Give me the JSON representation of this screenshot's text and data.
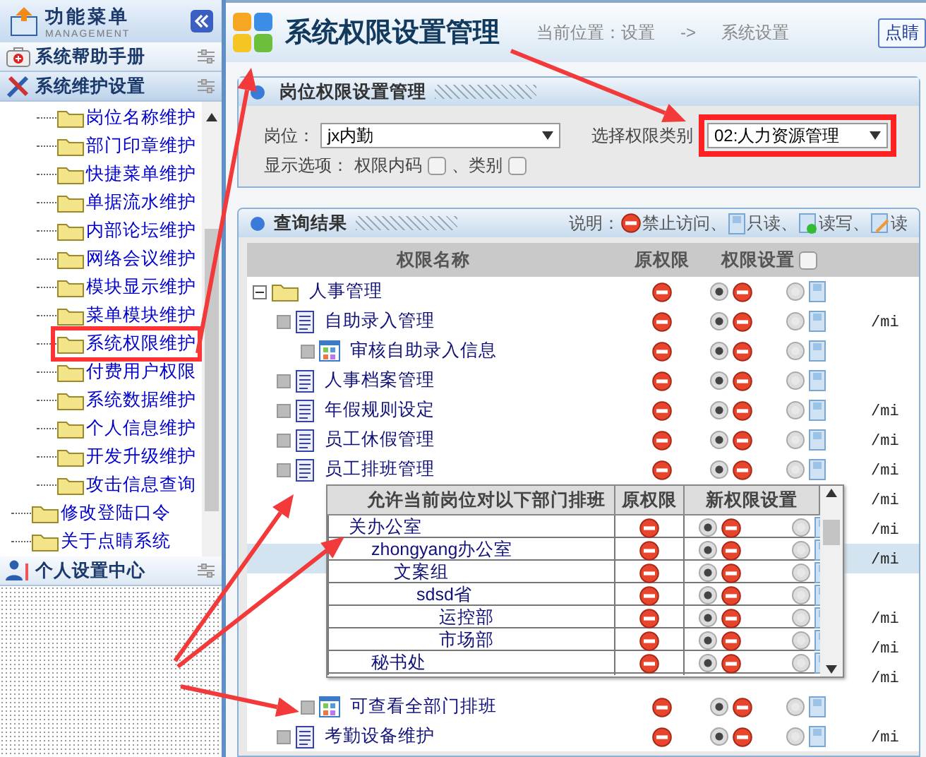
{
  "sidebar": {
    "title": "功能菜单",
    "subtitle": "MANAGEMENT",
    "sections": [
      {
        "kind": "help",
        "label": "系统帮助手册",
        "expanded": false
      },
      {
        "kind": "tools",
        "label": "系统维护设置",
        "expanded": true,
        "items": [
          {
            "children": [
              {
                "label": "岗位名称维护",
                "selected": false
              },
              {
                "label": "部门印章维护",
                "selected": false
              },
              {
                "label": "快捷菜单维护",
                "selected": false
              },
              {
                "label": "单据流水维护",
                "selected": false
              },
              {
                "label": "内部论坛维护",
                "selected": false
              },
              {
                "label": "网络会议维护",
                "selected": false
              },
              {
                "label": "模块显示维护",
                "selected": false
              },
              {
                "label": "菜单模块维护",
                "selected": false
              },
              {
                "label": "系统权限维护",
                "selected": true
              },
              {
                "label": "付费用户权限",
                "selected": false
              },
              {
                "label": "系统数据维护",
                "selected": false
              },
              {
                "label": "个人信息维护",
                "selected": false
              },
              {
                "label": "开发升级维护",
                "selected": false
              },
              {
                "label": "攻击信息查询",
                "selected": false
              }
            ]
          },
          {
            "label": "修改登陆口令",
            "selected": false
          },
          {
            "label": "关于点睛系统",
            "selected": false
          }
        ]
      },
      {
        "kind": "user",
        "label": "个人设置中心",
        "expanded": false
      }
    ]
  },
  "header": {
    "title": "系统权限设置管理",
    "breadcrumb": [
      "当前位置：设置",
      "->",
      "系统设置"
    ],
    "button": "点睛"
  },
  "filter_panel": {
    "title": "岗位权限设置管理",
    "post_label": "岗位：",
    "post_value": "jx内勤",
    "category_label": "选择权限类别",
    "category_value": "02:人力资源管理",
    "category_highlighted": true,
    "options_label": "显示选项：",
    "options": [
      {
        "label": "权限内码",
        "checked": false
      },
      {
        "label": "、类别",
        "checked": false
      }
    ]
  },
  "results": {
    "title": "查询结果",
    "legend_label": "说明：",
    "legend": [
      {
        "kind": "forbid",
        "label": "禁止访问、"
      },
      {
        "kind": "readonly",
        "label": "只读、"
      },
      {
        "kind": "readwrite",
        "label": "读写、"
      },
      {
        "kind": "edit",
        "label": "读"
      }
    ],
    "columns": [
      "权限名称",
      "原权限",
      "权限设置"
    ],
    "select_all": false,
    "rows": [
      {
        "kind": "folder",
        "name": "人事管理",
        "expanded": true,
        "forbid_selected": true,
        "children": [
          {
            "kind": "page",
            "name": "自助录入管理",
            "path": "/mi",
            "forbid_selected": true,
            "children": [
              {
                "kind": "module",
                "name": "审核自助录入信息",
                "forbid_selected": true
              }
            ]
          },
          {
            "kind": "page",
            "name": "人事档案管理",
            "forbid_selected": true
          },
          {
            "kind": "page",
            "name": "年假规则设定",
            "path": "/mi",
            "forbid_selected": true
          },
          {
            "kind": "page",
            "name": "员工休假管理",
            "path": "/mi",
            "forbid_selected": true
          },
          {
            "kind": "page",
            "name": "员工排班管理",
            "path": "/mi",
            "forbid_selected": true,
            "children": [
              {
                "kind": "covered",
                "path": "/mi",
                "selected": false
              },
              {
                "kind": "covered",
                "path": "/mi",
                "selected": false
              },
              {
                "kind": "covered",
                "path": "/mi",
                "selected": true
              },
              {
                "kind": "covered",
                "selected": false
              },
              {
                "kind": "covered",
                "path": "/mi",
                "selected": false
              },
              {
                "kind": "covered",
                "path": "/mi",
                "selected": false
              },
              {
                "kind": "covered",
                "path": "/mi",
                "selected": false
              },
              {
                "kind": "module",
                "name": "可查看全部门排班",
                "forbid_selected": true
              }
            ]
          },
          {
            "kind": "page",
            "name": "考勤设备维护",
            "path": "/mi",
            "forbid_selected": true
          }
        ]
      }
    ]
  },
  "popup": {
    "columns": [
      "允许当前岗位对以下部门排班",
      "原权限",
      "新权限设置"
    ],
    "rows": [
      {
        "name": "关办公室",
        "forbid_selected": true,
        "children": [
          {
            "name": "zhongyang办公室",
            "forbid_selected": true,
            "children": [
              {
                "name": "文案组",
                "forbid_selected": true,
                "children": [
                  {
                    "name": "sdsd省",
                    "forbid_selected": true,
                    "children": [
                      {
                        "name": "运控部",
                        "forbid_selected": true
                      },
                      {
                        "name": "市场部",
                        "forbid_selected": true
                      }
                    ]
                  }
                ]
              }
            ]
          },
          {
            "name": "秘书处",
            "forbid_selected": true
          }
        ]
      }
    ]
  }
}
